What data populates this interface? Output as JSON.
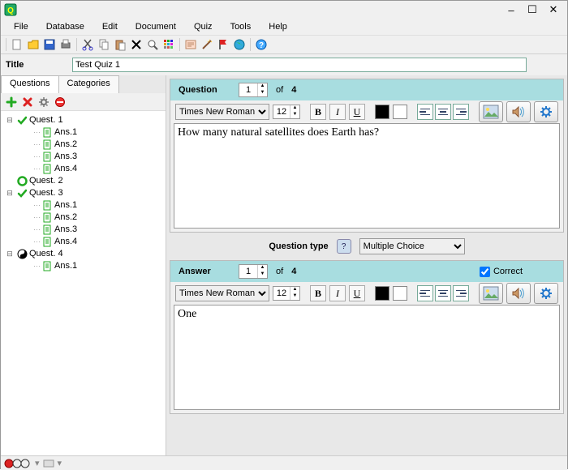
{
  "window": {
    "title": ""
  },
  "menu": [
    "File",
    "Database",
    "Edit",
    "Document",
    "Quiz",
    "Tools",
    "Help"
  ],
  "title_field": {
    "label": "Title",
    "value": "Test Quiz 1"
  },
  "left_tabs": [
    "Questions",
    "Categories"
  ],
  "tree": [
    {
      "label": "Quest. 1",
      "icon": "check-green",
      "expand": "-",
      "depth": 0
    },
    {
      "label": "Ans.1",
      "icon": "page",
      "depth": 1
    },
    {
      "label": "Ans.2",
      "icon": "page",
      "depth": 1
    },
    {
      "label": "Ans.3",
      "icon": "page",
      "depth": 1
    },
    {
      "label": "Ans.4",
      "icon": "page",
      "depth": 1
    },
    {
      "label": "Quest. 2",
      "icon": "circle-green",
      "depth": 0
    },
    {
      "label": "Quest. 3",
      "icon": "check-green",
      "expand": "-",
      "depth": 0
    },
    {
      "label": "Ans.1",
      "icon": "page",
      "depth": 1
    },
    {
      "label": "Ans.2",
      "icon": "page",
      "depth": 1
    },
    {
      "label": "Ans.3",
      "icon": "page",
      "depth": 1
    },
    {
      "label": "Ans.4",
      "icon": "page",
      "depth": 1
    },
    {
      "label": "Quest. 4",
      "icon": "yinyang",
      "expand": "-",
      "depth": 0
    },
    {
      "label": "Ans.1",
      "icon": "page",
      "depth": 1
    }
  ],
  "question": {
    "header_label": "Question",
    "current": "1",
    "of_label": "of",
    "total": "4",
    "font": "Times New Roman",
    "size": "12",
    "text": "How many natural satellites does Earth has?"
  },
  "qtype": {
    "label": "Question type",
    "selected": "Multiple Choice"
  },
  "answer": {
    "header_label": "Answer",
    "current": "1",
    "of_label": "of",
    "total": "4",
    "correct_label": "Correct",
    "correct_checked": true,
    "font": "Times New Roman",
    "size": "12",
    "text": "One"
  },
  "colors": {
    "black": "#000000",
    "white": "#ffffff",
    "teal_header": "#a8dde0"
  }
}
